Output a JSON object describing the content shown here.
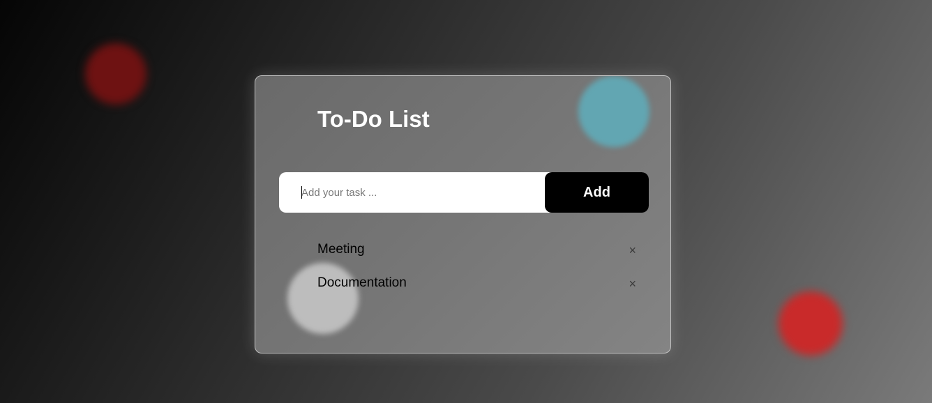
{
  "app": {
    "title": "To-Do List"
  },
  "input": {
    "placeholder": "Add your task ...",
    "value": ""
  },
  "add_button": {
    "label": "Add"
  },
  "tasks": [
    {
      "label": "Meeting",
      "delete_icon": "×"
    },
    {
      "label": "Documentation",
      "delete_icon": "×"
    }
  ],
  "icons": {
    "delete": "close-icon"
  },
  "colors": {
    "accent_button": "#000000",
    "title_text": "#ffffff",
    "blob_dark_red": "#6e1212",
    "blob_red": "#c92a2a",
    "blob_teal": "#62a6b2",
    "blob_white": "#bdbdbd"
  }
}
